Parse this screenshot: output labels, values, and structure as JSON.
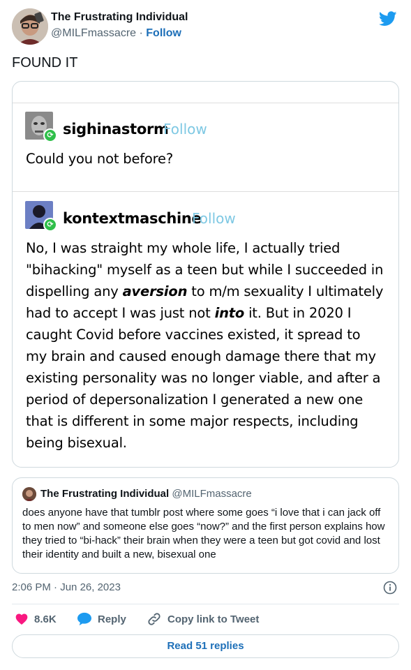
{
  "author": {
    "name": "The Frustrating Individual",
    "handle": "@MILFmassacre",
    "separator": "·",
    "follow_label": "Follow"
  },
  "tweet": {
    "text": "FOUND IT"
  },
  "tumblr": {
    "post1": {
      "username": "sighinastorm",
      "follow_label": "Follow",
      "text": "Could you not before?"
    },
    "post2": {
      "username": "kontextmaschine",
      "follow_label": "Follow",
      "lines": [
        "No, I was straight my whole life, I actually tried",
        "\"bihacking\" myself as a teen but while I succeeded in",
        "dispelling any",
        "aversion",
        "to m/m sexuality I ultimately",
        "had to accept I was just not",
        "into",
        "it. But in 2020 I",
        "caught Covid before vaccines existed, it spread to",
        "my brain and caused enough damage there that my",
        "existing personality was no longer viable, and after a",
        "period of depersonalization I generated a new one",
        "that is different in some major respects, including",
        "being bisexual."
      ]
    }
  },
  "quote": {
    "name": "The Frustrating Individual",
    "handle": "@MILFmassacre",
    "text": "does anyone have that tumblr post where some goes “i love that i can jack off to men now” and someone else goes “now?” and the first person explains how they tried to “bi-hack” their brain when they were a teen but got covid and lost their identity and built a new, bisexual one"
  },
  "meta": {
    "time": "2:06 PM",
    "separator": "·",
    "date": "Jun 26, 2023"
  },
  "actions": {
    "like_count": "8.6K",
    "reply_label": "Reply",
    "copy_label": "Copy link to Tweet"
  },
  "replies_button": "Read 51 replies",
  "colors": {
    "twitter_blue": "#1d9bf0",
    "link_blue": "#1d6fb8",
    "like_red": "#f91880",
    "tumblr_follow": "#7ec8e3",
    "reblog_green": "#2fbf4a"
  },
  "icons": [
    "twitter-bird-icon",
    "heart-icon",
    "reply-bubble-icon",
    "link-icon",
    "info-icon",
    "reblog-icon"
  ]
}
